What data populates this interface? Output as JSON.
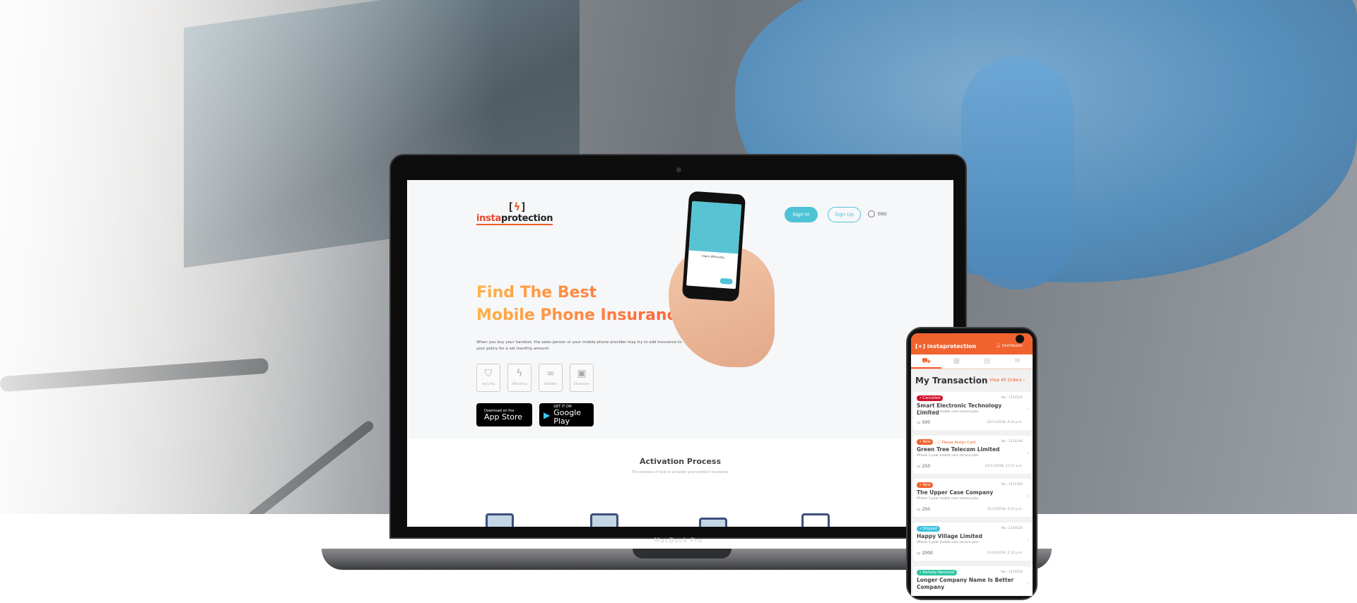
{
  "laptop": {
    "brand": "MacBook Pro",
    "logo_text_a": "insta",
    "logo_text_b": "protection",
    "nav": {
      "sign_in": "Sign In",
      "sign_up": "Sign Up",
      "language": "ENG"
    },
    "hero": {
      "title_line1": "Find The Best",
      "title_line2": "Mobile Phone Insurance",
      "description": "When you buy your handset, the sales person or your mobile phone provider may try to add insurance to your policy for a set monthly amount.",
      "features": [
        {
          "label": "Security",
          "icon": "shield-icon"
        },
        {
          "label": "Efficiency",
          "icon": "lightning-shield-icon"
        },
        {
          "label": "Reliable",
          "icon": "circles-icon"
        },
        {
          "label": "Electronic",
          "icon": "device-icon"
        }
      ],
      "app_store": {
        "small": "Download on the",
        "big": "App Store"
      },
      "google_play": {
        "small": "GET IT ON",
        "big": "Google Play"
      },
      "phone_screen_title": "Claim Efficiently"
    },
    "activation": {
      "title": "Activation Process",
      "subtitle": "The process of how to activate your product insurance"
    }
  },
  "phone": {
    "logo": "[+] instaprotection",
    "user_label": "Distributor",
    "title": "My Transaction",
    "view_all": "View All Orders ›",
    "colors": {
      "accent": "#f0622e",
      "cancelled": "#d0112b",
      "new": "#f0622e",
      "shipped": "#3bbfdc",
      "partial": "#2ec4a0"
    },
    "orders": [
      {
        "status": "• Cancelled",
        "status_color": "#d0112b",
        "warning": "",
        "no": "No.: 1234524",
        "company": "Smart Electronic Technology Limited",
        "plan": "iPhone 1-year mobile care service plan",
        "amount": "500",
        "date": "22/11/2018, 6:23 p.m."
      },
      {
        "status": "• New",
        "status_color": "#f0622e",
        "warning": "ⓘ Please Assign Card",
        "no": "No.: 1231244",
        "company": "Green Tree Telecom Limited",
        "plan": "iPhone 1-year mobile care service plan",
        "amount": "250",
        "date": "23/11/2018, 11:21 a.m."
      },
      {
        "status": "• New",
        "status_color": "#f0622e",
        "warning": "",
        "no": "No.: 1231356",
        "company": "The Upper Case Company",
        "plan": "iPhone 1-year mobile care service plan",
        "amount": "250",
        "date": "21/11/2018, 4:21 p.m."
      },
      {
        "status": "• Shipped",
        "status_color": "#3bbfdc",
        "warning": "",
        "no": "No.: 1234524",
        "company": "Happy Village Limited",
        "plan": "iPhone 1-year mobile care service plan",
        "amount": "2000",
        "date": "21/12/2018, 2:12 p.m."
      },
      {
        "status": "• Partially Received",
        "status_color": "#2ec4a0",
        "warning": "",
        "no": "No.: 1234524",
        "company": "Longer Company Name Is Better Company",
        "plan": "",
        "amount": "",
        "date": ""
      }
    ]
  }
}
